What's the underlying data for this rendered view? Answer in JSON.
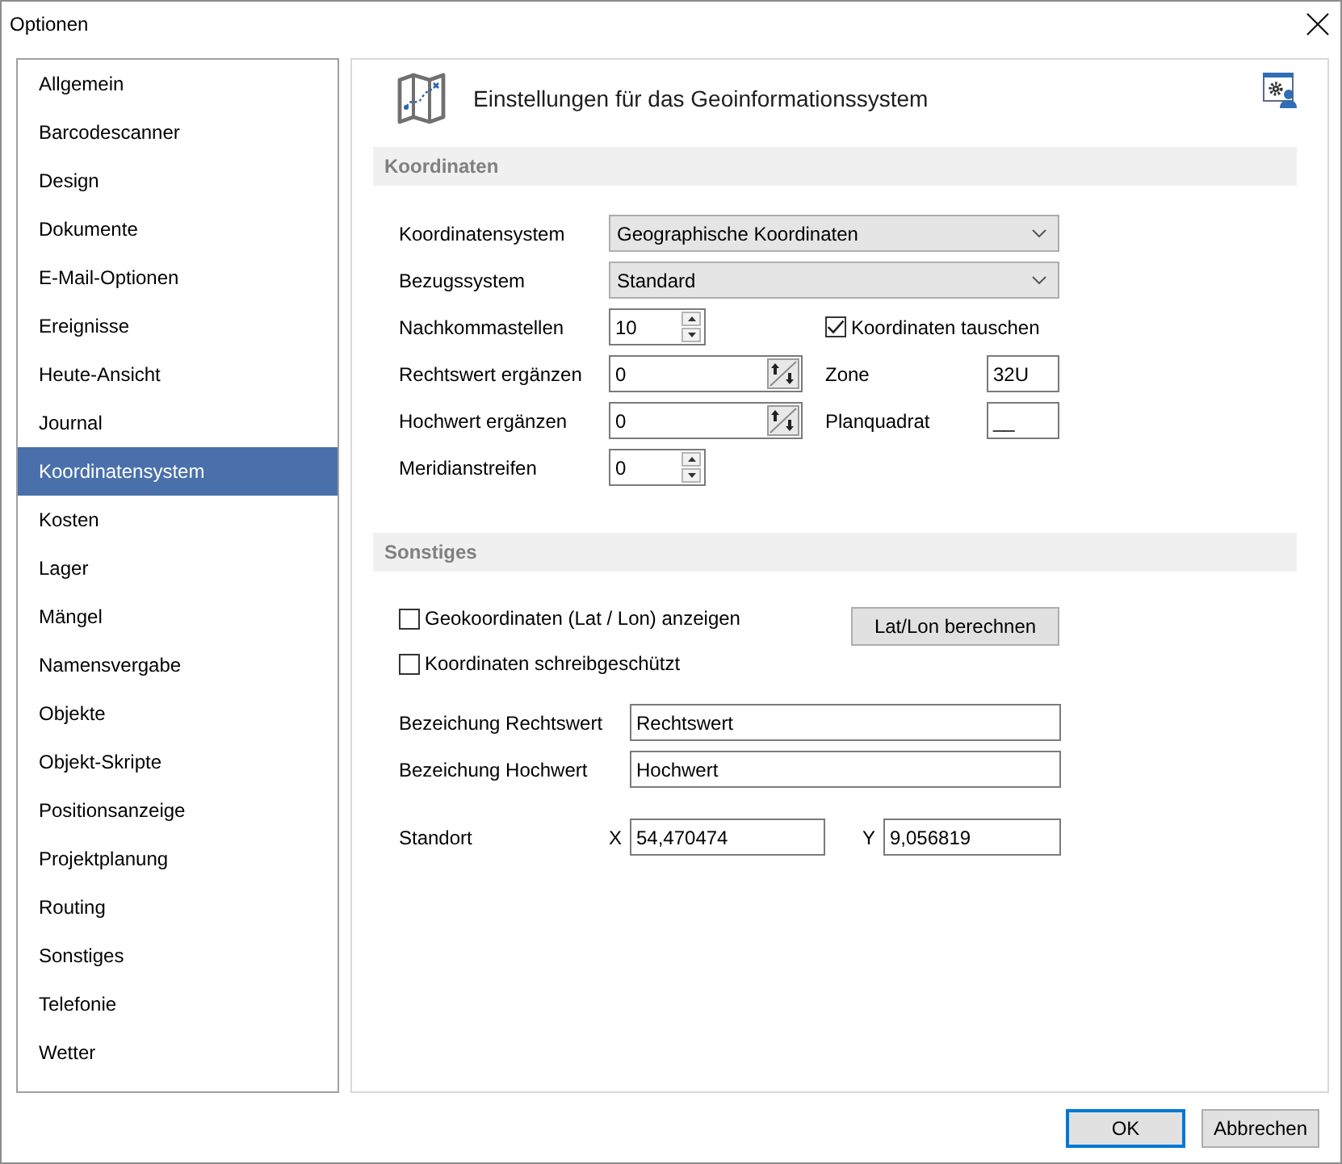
{
  "window": {
    "title": "Optionen"
  },
  "sidebar": {
    "items": [
      {
        "label": "Allgemein",
        "selected": false
      },
      {
        "label": "Barcodescanner",
        "selected": false
      },
      {
        "label": "Design",
        "selected": false
      },
      {
        "label": "Dokumente",
        "selected": false
      },
      {
        "label": "E-Mail-Optionen",
        "selected": false
      },
      {
        "label": "Ereignisse",
        "selected": false
      },
      {
        "label": "Heute-Ansicht",
        "selected": false
      },
      {
        "label": "Journal",
        "selected": false
      },
      {
        "label": "Koordinatensystem",
        "selected": true
      },
      {
        "label": "Kosten",
        "selected": false
      },
      {
        "label": "Lager",
        "selected": false
      },
      {
        "label": "Mängel",
        "selected": false
      },
      {
        "label": "Namensvergabe",
        "selected": false
      },
      {
        "label": "Objekte",
        "selected": false
      },
      {
        "label": "Objekt-Skripte",
        "selected": false
      },
      {
        "label": "Positionsanzeige",
        "selected": false
      },
      {
        "label": "Projektplanung",
        "selected": false
      },
      {
        "label": "Routing",
        "selected": false
      },
      {
        "label": "Sonstiges",
        "selected": false
      },
      {
        "label": "Telefonie",
        "selected": false
      },
      {
        "label": "Wetter",
        "selected": false
      }
    ]
  },
  "header": {
    "title": "Einstellungen für das Geoinformationssystem"
  },
  "coordinates": {
    "title": "Koordinaten",
    "rows": [
      {
        "kind": "dropdown",
        "label": "Koordinatensystem",
        "value": "Geographische Koordinaten"
      },
      {
        "kind": "dropdown",
        "label": "Bezugssystem",
        "value": "Standard"
      },
      {
        "kind": "spinner",
        "label": "Nachkommastellen",
        "value": "10",
        "side": {
          "kind": "checkbox",
          "label": "Koordinaten tauschen",
          "checked": true
        }
      },
      {
        "kind": "offset",
        "label": "Rechtswert ergänzen",
        "value": "0",
        "side": {
          "kind": "text",
          "label": "Zone",
          "value": "32U"
        }
      },
      {
        "kind": "offset",
        "label": "Hochwert ergänzen",
        "value": "0",
        "side": {
          "kind": "text",
          "label": "Planquadrat",
          "value": "__"
        }
      },
      {
        "kind": "spinner",
        "label": "Meridianstreifen",
        "value": "0"
      }
    ]
  },
  "other": {
    "title": "Sonstiges",
    "checkboxes": [
      {
        "label": "Geokoordinaten (Lat / Lon) anzeigen",
        "checked": false
      },
      {
        "label": "Koordinaten schreibgeschützt",
        "checked": false
      }
    ],
    "button": "Lat/Lon berechnen",
    "fields": [
      {
        "label": "Bezeichung Rechtswert",
        "value": "Rechtswert"
      },
      {
        "label": "Bezeichung Hochwert",
        "value": "Hochwert"
      }
    ],
    "location": {
      "label": "Standort",
      "x_label": "X",
      "x_value": "54,470474",
      "y_label": "Y",
      "y_value": "9,056819"
    }
  },
  "buttons": [
    {
      "label": "OK",
      "default": true
    },
    {
      "label": "Abbrechen",
      "default": false
    }
  ]
}
